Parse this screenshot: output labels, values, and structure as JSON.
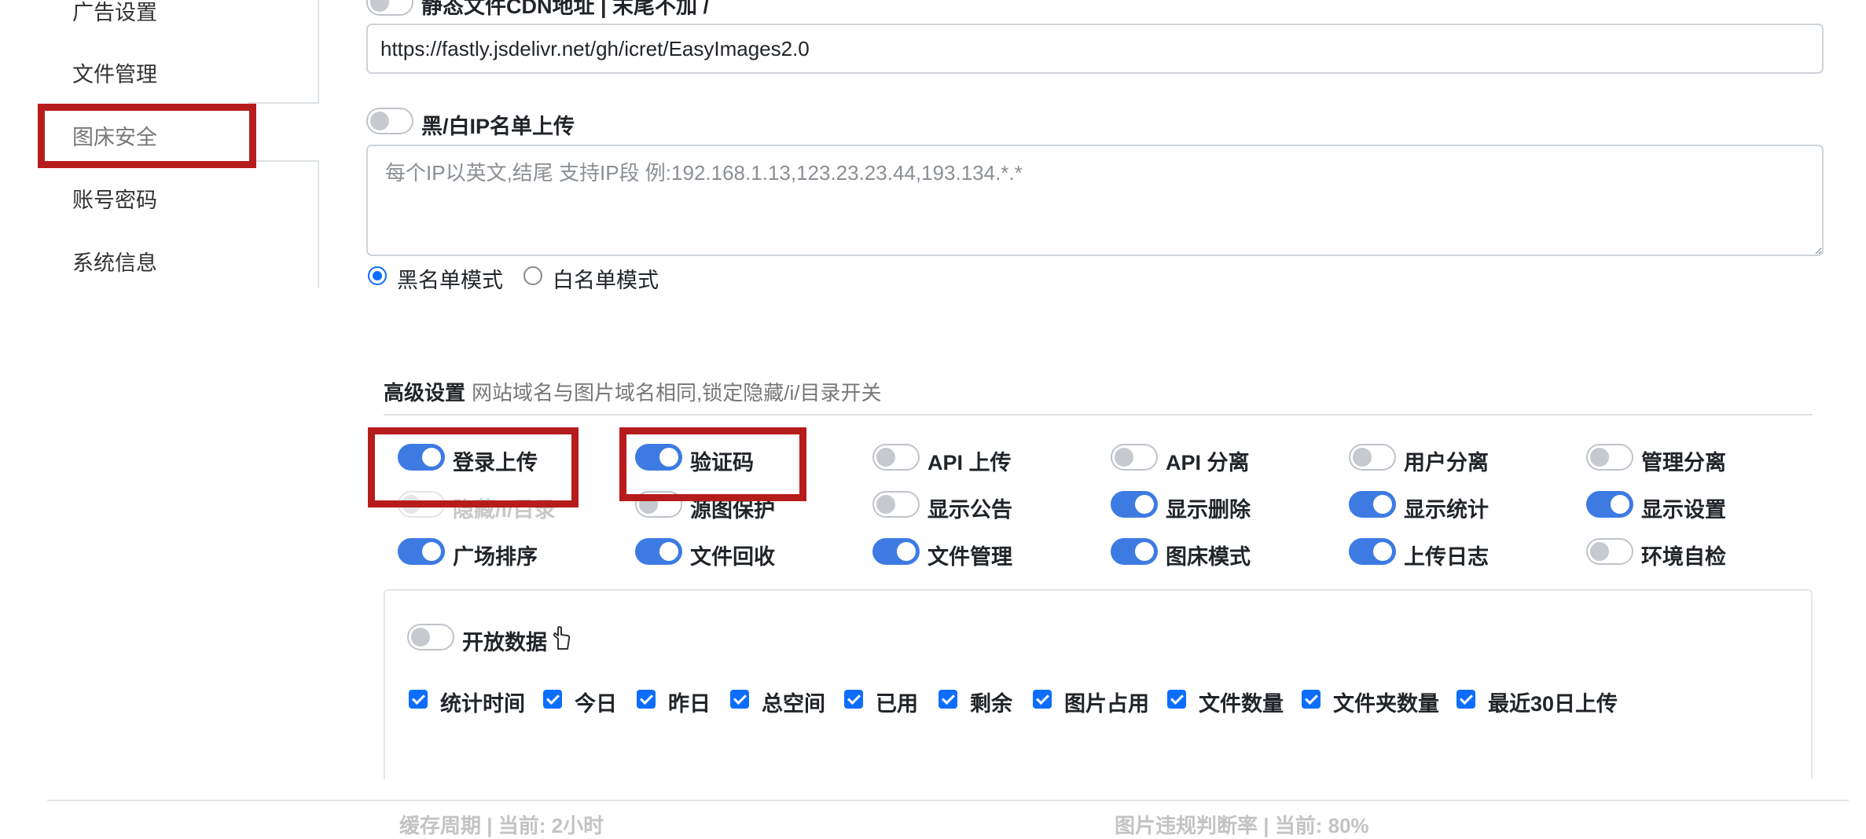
{
  "sidebar": {
    "items": [
      {
        "label": "广告设置"
      },
      {
        "label": "文件管理"
      },
      {
        "label": "图床安全"
      },
      {
        "label": "账号密码"
      },
      {
        "label": "系统信息"
      }
    ]
  },
  "cdn": {
    "label": "静态文件CDN地址 | 末尾不加 /",
    "value": "https://fastly.jsdelivr.net/gh/icret/EasyImages2.0"
  },
  "ip_list": {
    "label": "黑/白IP名单上传",
    "placeholder": "每个IP以英文,结尾 支持IP段 例:192.168.1.13,123.23.23.44,193.134.*.*",
    "mode_black": "黑名单模式",
    "mode_white": "白名单模式"
  },
  "advanced": {
    "title": "高级设置",
    "subtitle": "网站域名与图片域名相同,锁定隐藏/i/目录开关",
    "switches": [
      {
        "label": "登录上传",
        "on": true
      },
      {
        "label": "验证码",
        "on": true
      },
      {
        "label": "API 上传",
        "on": false
      },
      {
        "label": "API 分离",
        "on": false
      },
      {
        "label": "用户分离",
        "on": false
      },
      {
        "label": "管理分离",
        "on": false
      },
      {
        "label": "隐藏/i/目录",
        "on": false
      },
      {
        "label": "源图保护",
        "on": false
      },
      {
        "label": "显示公告",
        "on": false
      },
      {
        "label": "显示删除",
        "on": true
      },
      {
        "label": "显示统计",
        "on": true
      },
      {
        "label": "显示设置",
        "on": true
      },
      {
        "label": "广场排序",
        "on": true
      },
      {
        "label": "文件回收",
        "on": true
      },
      {
        "label": "文件管理",
        "on": true
      },
      {
        "label": "图床模式",
        "on": true
      },
      {
        "label": "上传日志",
        "on": true
      },
      {
        "label": "环境自检",
        "on": false
      }
    ]
  },
  "open_data": {
    "label": "开放数据",
    "icon": "hand-pointer-icon",
    "checkboxes": [
      "统计时间",
      "今日",
      "昨日",
      "总空间",
      "已用",
      "剩余",
      "图片占用",
      "文件数量",
      "文件夹数量",
      "最近30日上传"
    ]
  },
  "footer": {
    "cache": "缓存周期 | 当前: 2小时",
    "violation": "图片违规判断率 | 当前: 80%"
  },
  "colors": {
    "accent": "#3d7be3",
    "highlight_box": "#b71c1c"
  }
}
